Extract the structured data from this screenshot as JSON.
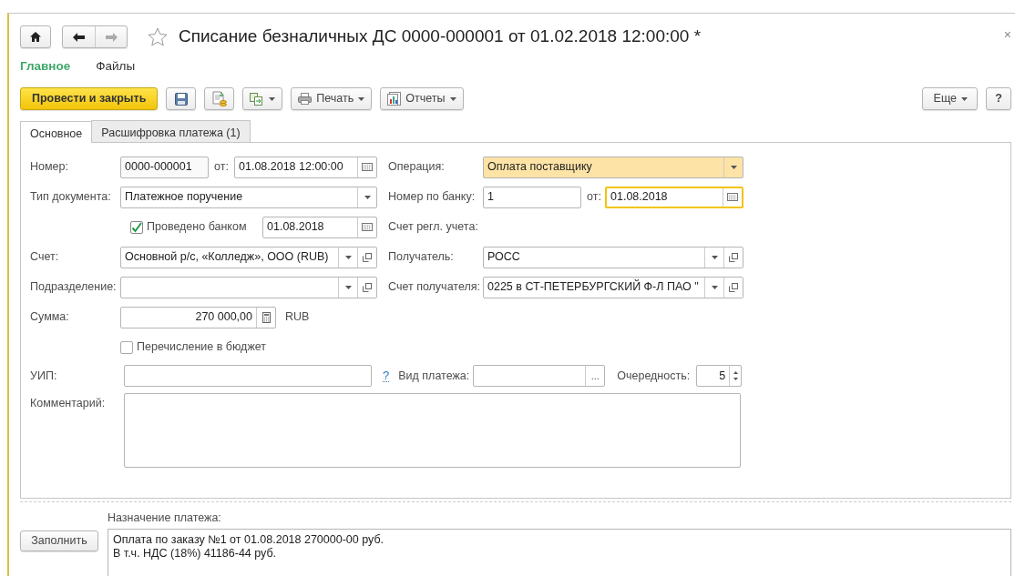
{
  "window": {
    "title": "Списание безналичных ДС 0000-000001 от 01.02.2018 12:00:00 *",
    "close": "×"
  },
  "sections": [
    {
      "label": "Главное",
      "selected": true
    },
    {
      "label": "Файлы",
      "selected": false
    }
  ],
  "toolbar": {
    "primary": "Провести и закрыть",
    "print": "Печать",
    "reports": "Отчеты",
    "more": "Еще",
    "help": "?"
  },
  "tabs": [
    {
      "label": "Основное",
      "selected": true
    },
    {
      "label": "Расшифровка платежа (1)",
      "selected": false
    }
  ],
  "form": {
    "number": {
      "label": "Номер:",
      "value": "0000-000001",
      "date_label": "от:",
      "date": "01.08.2018 12:00:00"
    },
    "operation": {
      "label": "Операция:",
      "value": "Оплата поставщику",
      "highlighted": true
    },
    "doc_type": {
      "label": "Тип документа:",
      "value": "Платежное поручение"
    },
    "bank_number": {
      "label": "Номер по банку:",
      "value": "1",
      "date_label": "от:",
      "date": "01.08.2018",
      "focused": true
    },
    "bank_posted": {
      "label": "Проведено банком",
      "checked": true,
      "date": "01.08.2018"
    },
    "reg_account": {
      "label": "Счет регл. учета:"
    },
    "account": {
      "label": "Счет:",
      "value": "Основной р/с, «Колледж», ООО (RUB)"
    },
    "recipient": {
      "label": "Получатель:",
      "value": "РОСС"
    },
    "department": {
      "label": "Подразделение:"
    },
    "recipient_account": {
      "label": "Счет получателя:",
      "value": "0225 в СТ-ПЕТЕРБУРГСКИЙ Ф-Л ПАО \""
    },
    "amount": {
      "label": "Сумма:",
      "value": "270 000,00",
      "currency": "RUB"
    },
    "budget_transfer": {
      "label": "Перечисление в бюджет",
      "checked": false
    },
    "uip": {
      "label": "УИП:",
      "help": "?"
    },
    "payment_type": {
      "label": "Вид платежа:",
      "button": "..."
    },
    "priority": {
      "label": "Очередность:",
      "value": "5"
    },
    "comment": {
      "label": "Комментарий:"
    }
  },
  "purpose": {
    "label": "Назначение платежа:",
    "fill_button": "Заполнить",
    "lines": [
      "Оплата по заказу №1 от 01.08.2018 270000-00 руб.",
      "В т.ч. НДС (18%) 41186-44 руб."
    ]
  }
}
